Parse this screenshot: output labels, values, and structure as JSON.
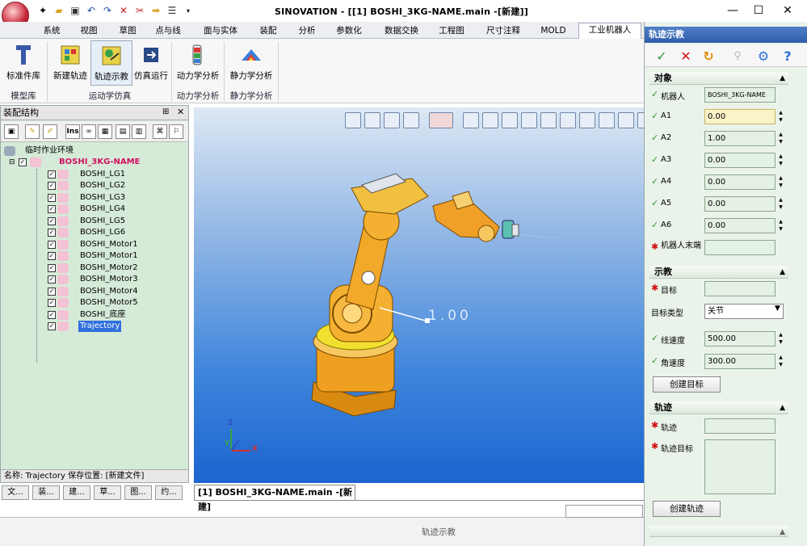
{
  "app": {
    "title": "SINOVATION - [[1] BOSHI_3KG-NAME.main -[新建]]",
    "window_controls": [
      "minimize",
      "maximize",
      "close"
    ]
  },
  "quick_access": [
    "new-icon",
    "open-icon",
    "save-icon",
    "undo-icon",
    "redo-icon",
    "delete-icon",
    "cut-icon",
    "arrow-icon",
    "list-icon",
    "dropdown-icon"
  ],
  "tabs": [
    {
      "label": "系统"
    },
    {
      "label": "视图"
    },
    {
      "label": "草图"
    },
    {
      "label": "点与线"
    },
    {
      "label": "面与实体"
    },
    {
      "label": "装配"
    },
    {
      "label": "分析"
    },
    {
      "label": "参数化"
    },
    {
      "label": "数据交换"
    },
    {
      "label": "工程图"
    },
    {
      "label": "尺寸注释"
    },
    {
      "label": "MOLD"
    },
    {
      "label": "工业机器人",
      "active": true
    }
  ],
  "ribbon": {
    "buttons": [
      "标准件库",
      "新建轨迹",
      "轨迹示教",
      "仿真运行",
      "动力学分析",
      "静力学分析"
    ],
    "groups": [
      "模型库",
      "运动学仿真",
      "动力学分析",
      "静力学分析"
    ]
  },
  "left_panel": {
    "title": "装配结构",
    "tree": [
      {
        "label": "临时作业环境"
      },
      {
        "label": "BOSHI_3KG-NAME"
      },
      {
        "label": "BOSHI_LG1"
      },
      {
        "label": "BOSHI_LG2"
      },
      {
        "label": "BOSHI_LG3"
      },
      {
        "label": "BOSHI_LG4"
      },
      {
        "label": "BOSHI_LG5"
      },
      {
        "label": "BOSHI_LG6"
      },
      {
        "label": "BOSHI_Motor1"
      },
      {
        "label": "BOSHI_Motor1"
      },
      {
        "label": "BOSHI_Motor2"
      },
      {
        "label": "BOSHI_Motor3"
      },
      {
        "label": "BOSHI_Motor4"
      },
      {
        "label": "BOSHI_Motor5"
      },
      {
        "label": "BOSHI_底座"
      },
      {
        "label": "Trajectory"
      }
    ],
    "footer": "名称: Trajectory 保存位置: [新建文件]",
    "bottom_tabs": [
      "文...",
      "装...",
      "建...",
      "草...",
      "图...",
      "约..."
    ]
  },
  "viewport": {
    "dimension_label": "1.00",
    "axis": {
      "x": "X",
      "y": "Y",
      "z": "Z"
    }
  },
  "doc_tab": "[1] BOSHI_3KG-NAME.main -[新建]",
  "status_text": "轨迹示教",
  "right_panel": {
    "title": "轨迹示教",
    "section_object": {
      "title": "对象",
      "robot_label": "机器人",
      "robot_value": "BOSHI_3KG-NAME",
      "joints": [
        {
          "label": "A1",
          "value": "0.00"
        },
        {
          "label": "A2",
          "value": "1.00"
        },
        {
          "label": "A3",
          "value": "0.00"
        },
        {
          "label": "A4",
          "value": "0.00"
        },
        {
          "label": "A5",
          "value": "0.00"
        },
        {
          "label": "A6",
          "value": "0.00"
        }
      ],
      "end_label": "机器人末端",
      "end_value": ""
    },
    "section_teach": {
      "title": "示教",
      "target_label": "目标",
      "target_value": "",
      "type_label": "目标类型",
      "type_value": "关节",
      "linear_label": "线速度",
      "linear_value": "500.00",
      "angular_label": "角速度",
      "angular_value": "300.00",
      "create_target": "创建目标"
    },
    "section_traj": {
      "title": "轨迹",
      "traj_label": "轨迹",
      "traj_value": "",
      "traj_target_label": "轨迹目标",
      "create_traj": "创建轨迹"
    }
  }
}
